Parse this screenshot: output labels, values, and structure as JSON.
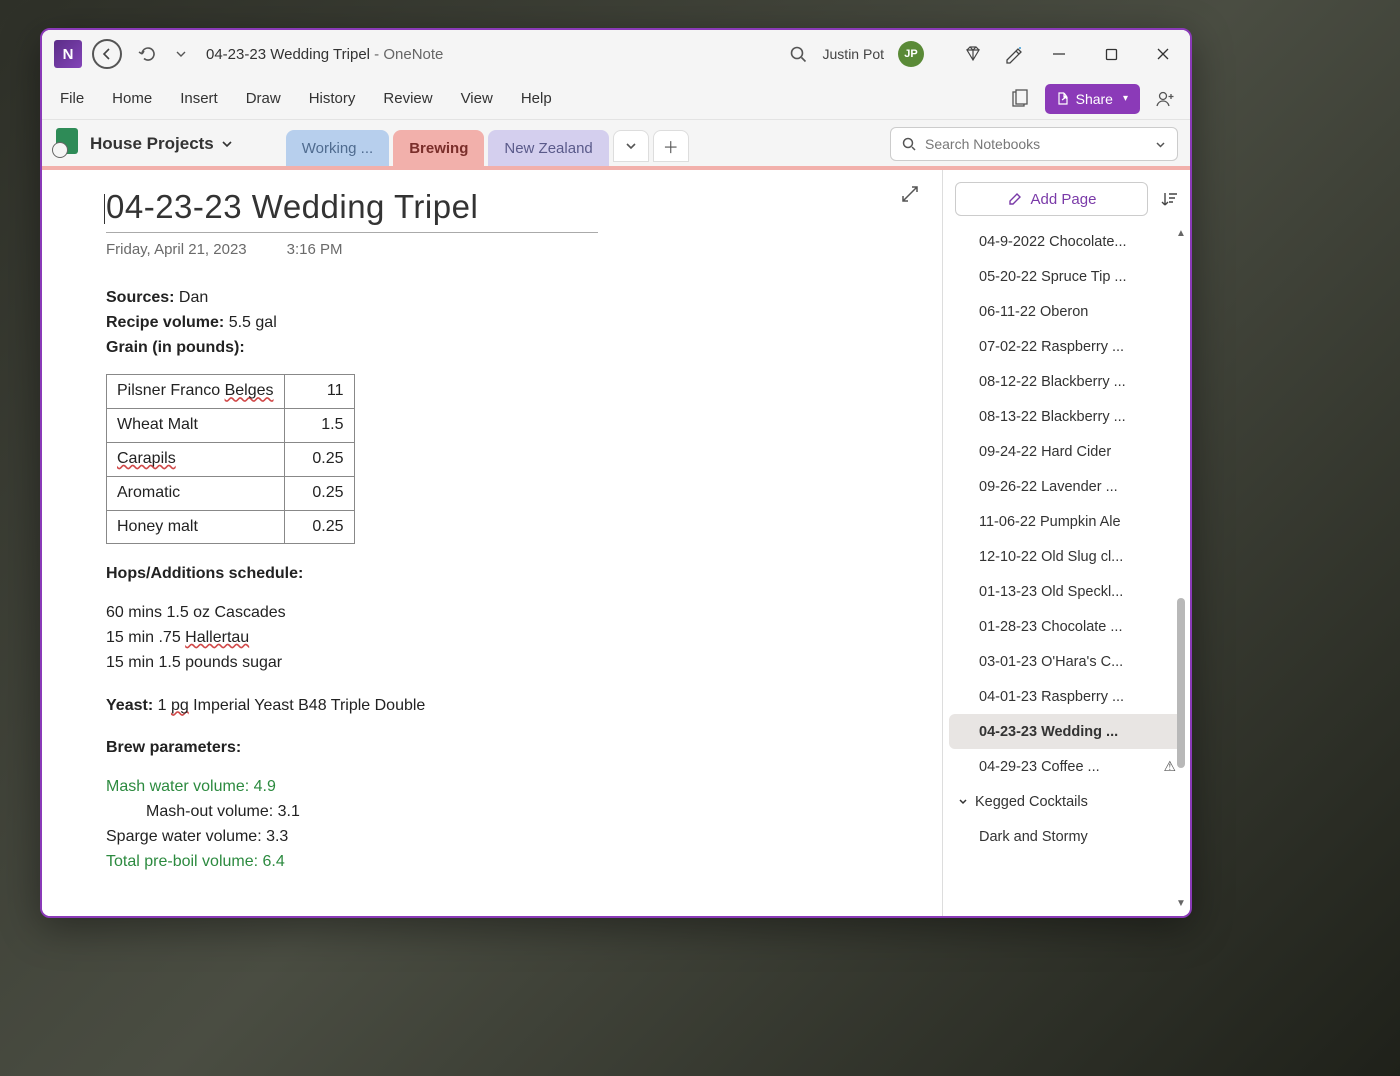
{
  "title": {
    "doc": "04-23-23 Wedding Tripel",
    "sep": "  -  ",
    "app": "OneNote"
  },
  "user": {
    "name": "Justin Pot",
    "initials": "JP"
  },
  "menus": [
    "File",
    "Home",
    "Insert",
    "Draw",
    "History",
    "Review",
    "View",
    "Help"
  ],
  "share_label": "Share",
  "notebook": {
    "name": "House Projects"
  },
  "sections": [
    {
      "label": "Working ...",
      "cls": "sec-blue"
    },
    {
      "label": "Brewing",
      "cls": "sec-red"
    },
    {
      "label": "New Zealand",
      "cls": "sec-purple"
    }
  ],
  "search_placeholder": "Search Notebooks",
  "page": {
    "title": "04-23-23 Wedding Tripel",
    "date": "Friday, April 21, 2023",
    "time": "3:16 PM",
    "sources_label": "Sources:",
    "sources_value": " Dan",
    "volume_label": "Recipe volume:",
    "volume_value": " 5.5 gal",
    "grain_label": "Grain (in pounds):",
    "grain_rows": [
      {
        "name_pre": "Pilsner Franco ",
        "name_spell": "Belges",
        "name_post": "",
        "val": "11"
      },
      {
        "name_pre": "Wheat Malt",
        "name_spell": "",
        "name_post": "",
        "val": "1.5"
      },
      {
        "name_pre": "",
        "name_spell": "Carapils",
        "name_post": "",
        "val": "0.25"
      },
      {
        "name_pre": "Aromatic",
        "name_spell": "",
        "name_post": "",
        "val": "0.25"
      },
      {
        "name_pre": "Honey malt",
        "name_spell": "",
        "name_post": "",
        "val": "0.25"
      }
    ],
    "hops_label": "Hops/Additions schedule:",
    "hops_lines": [
      {
        "pre": "60 mins 1.5 oz Cascades",
        "spell": "",
        "post": ""
      },
      {
        "pre": "15 min .75 ",
        "spell": "Hallertau",
        "post": ""
      },
      {
        "pre": "15 min 1.5 pounds sugar",
        "spell": "",
        "post": ""
      }
    ],
    "yeast_label": "Yeast:",
    "yeast_pre": " 1 ",
    "yeast_spell": "pg",
    "yeast_post": " Imperial Yeast B48 Triple Double",
    "brew_label": "Brew parameters:",
    "mash_water": "Mash water volume: 4.9",
    "mash_out": "Mash-out volume: 3.1",
    "sparge": "Sparge water volume: 3.3",
    "preboil": "Total pre-boil volume: 6.4"
  },
  "add_page_label": "Add Page",
  "pages": [
    "04-9-2022 Chocolate...",
    "05-20-22 Spruce Tip ...",
    "06-11-22 Oberon",
    "07-02-22 Raspberry ...",
    "08-12-22 Blackberry ...",
    "08-13-22 Blackberry ...",
    "09-24-22 Hard Cider",
    "09-26-22 Lavender ...",
    "11-06-22 Pumpkin Ale",
    "12-10-22 Old Slug cl...",
    "01-13-23 Old Speckl...",
    "01-28-23 Chocolate ...",
    "03-01-23 O'Hara's C...",
    "04-01-23 Raspberry ...",
    "04-23-23 Wedding ...",
    "04-29-23 Coffee ..."
  ],
  "pages_active_index": 14,
  "pages_warn_index": 15,
  "group_label": "Kegged Cocktails",
  "group_child": "Dark and Stormy"
}
